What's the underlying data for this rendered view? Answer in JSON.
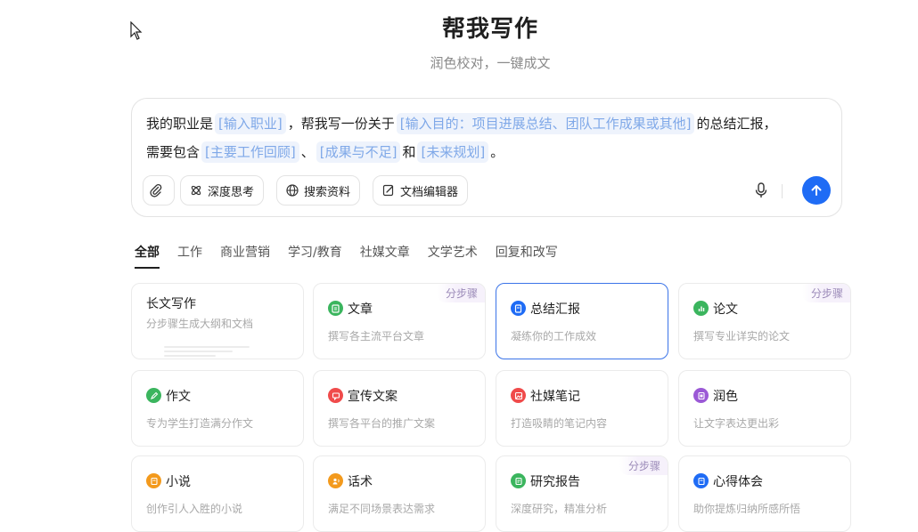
{
  "header": {
    "title": "帮我写作",
    "subtitle": "润色校对，一键成文"
  },
  "prompt": {
    "line1_a": "我的职业是",
    "slot_job": "[输入职业]",
    "line1_b": "，帮我写一份关于",
    "slot_purpose": "[输入目的：项目进展总结、团队工作成果或其他]",
    "line1_c": "的总结汇报，",
    "line2_a": "需要包含",
    "slot_review": "[主要工作回顾]",
    "sep1": "、",
    "slot_result": "[成果与不足]",
    "and": "和",
    "slot_plan": "[未来规划]",
    "end": "。"
  },
  "toolbar": {
    "deep_think": "深度思考",
    "search": "搜索资料",
    "doc_editor": "文档编辑器"
  },
  "tabs": [
    "全部",
    "工作",
    "商业营销",
    "学习/教育",
    "社媒文章",
    "文学艺术",
    "回复和改写"
  ],
  "cards": [
    {
      "title": "长文写作",
      "desc": "分步骤生成大纲和文档",
      "icon": "none",
      "color": "",
      "badge": ""
    },
    {
      "title": "文章",
      "desc": "撰写各主流平台文章",
      "icon": "doc-icon",
      "color": "#3bb55e",
      "badge": "分步骤"
    },
    {
      "title": "总结汇报",
      "desc": "凝练你的工作成效",
      "icon": "report-icon",
      "color": "#1f6cf5",
      "badge": ""
    },
    {
      "title": "论文",
      "desc": "撰写专业详实的论文",
      "icon": "chart-icon",
      "color": "#3bb55e",
      "badge": "分步骤"
    },
    {
      "title": "作文",
      "desc": "专为学生打造满分作文",
      "icon": "pen-icon",
      "color": "#3bb55e",
      "badge": ""
    },
    {
      "title": "宣传文案",
      "desc": "撰写各平台的推广文案",
      "icon": "chat-icon",
      "color": "#f04b4b",
      "badge": ""
    },
    {
      "title": "社媒笔记",
      "desc": "打造吸睛的笔记内容",
      "icon": "image-icon",
      "color": "#f04b4b",
      "badge": ""
    },
    {
      "title": "润色",
      "desc": "让文字表达更出彩",
      "icon": "polish-icon",
      "color": "#9b59d6",
      "badge": ""
    },
    {
      "title": "小说",
      "desc": "创作引人入胜的小说",
      "icon": "book-icon",
      "color": "#f39a1d",
      "badge": ""
    },
    {
      "title": "话术",
      "desc": "满足不同场景表达需求",
      "icon": "person-icon",
      "color": "#f39a1d",
      "badge": ""
    },
    {
      "title": "研究报告",
      "desc": "深度研究，精准分析",
      "icon": "research-icon",
      "color": "#3bb55e",
      "badge": "分步骤"
    },
    {
      "title": "心得体会",
      "desc": "助你提炼归纳所感所悟",
      "icon": "note-icon",
      "color": "#1f6cf5",
      "badge": ""
    }
  ]
}
